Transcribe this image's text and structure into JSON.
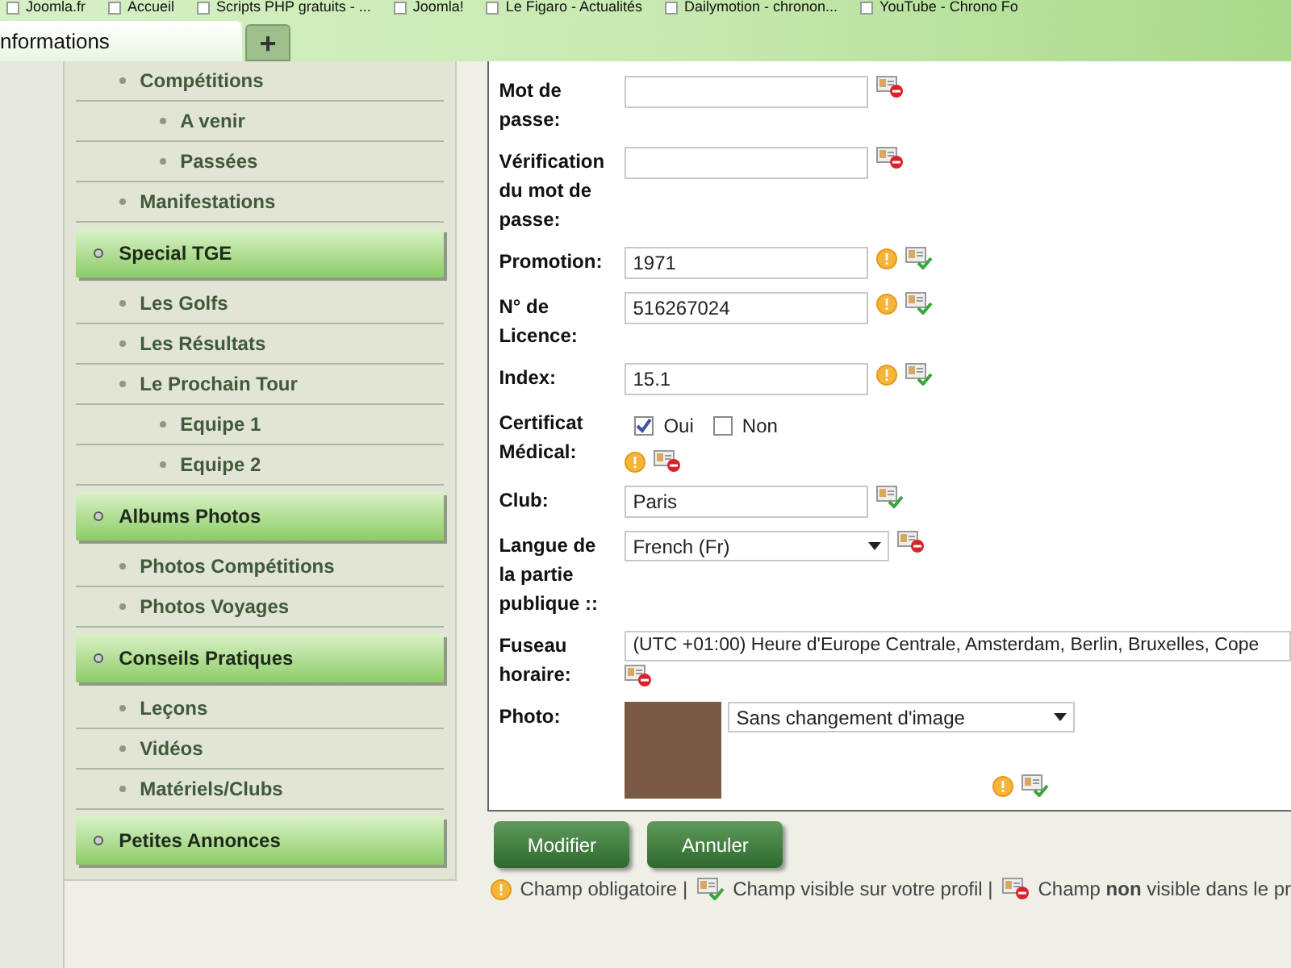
{
  "bookmarks": [
    {
      "label": "Joomla.fr"
    },
    {
      "label": "Accueil"
    },
    {
      "label": "Scripts PHP gratuits - ..."
    },
    {
      "label": "Joomla!"
    },
    {
      "label": "Le Figaro - Actualités"
    },
    {
      "label": "Dailymotion - chronon..."
    },
    {
      "label": "YouTube - Chrono Fo"
    }
  ],
  "tabs": [
    {
      "label": "nformations",
      "selected": true
    }
  ],
  "new_tab": "+",
  "sidebar": [
    {
      "kind": "link",
      "label": "Compétitions",
      "children": [
        {
          "kind": "link",
          "label": "A venir"
        },
        {
          "kind": "link",
          "label": "Passées"
        }
      ]
    },
    {
      "kind": "link",
      "label": "Manifestations"
    },
    {
      "kind": "section",
      "label": "Special TGE",
      "children": [
        {
          "kind": "link",
          "label": "Les Golfs"
        },
        {
          "kind": "link",
          "label": "Les Résultats"
        },
        {
          "kind": "link",
          "label": "Le Prochain Tour",
          "children": [
            {
              "kind": "link",
              "label": "Equipe 1"
            },
            {
              "kind": "link",
              "label": "Equipe 2"
            }
          ]
        }
      ]
    },
    {
      "kind": "section",
      "label": "Albums Photos",
      "children": [
        {
          "kind": "link",
          "label": "Photos Compétitions"
        },
        {
          "kind": "link",
          "label": "Photos Voyages"
        }
      ]
    },
    {
      "kind": "section",
      "label": "Conseils Pratiques",
      "children": [
        {
          "kind": "link",
          "label": "Leçons"
        },
        {
          "kind": "link",
          "label": "Vidéos"
        },
        {
          "kind": "link",
          "label": "Matériels/Clubs"
        }
      ]
    },
    {
      "kind": "section",
      "label": "Petites Annonces"
    }
  ],
  "form": [
    {
      "kind": "text",
      "label": "Mot de passe:",
      "required": false,
      "public": false
    },
    {
      "kind": "text",
      "label": "Vérification du mot de passe:",
      "required": false,
      "public": false
    },
    {
      "kind": "text",
      "label": "Promotion:",
      "value": "1971",
      "required": true,
      "public": true
    },
    {
      "kind": "text",
      "label": "N° de Licence:",
      "value": "516267024",
      "required": true,
      "public": true
    },
    {
      "kind": "text",
      "label": "Index:",
      "value": "15.1",
      "required": true,
      "public": true
    },
    {
      "kind": "checkboxes",
      "label": "Certificat Médical:",
      "options": [
        {
          "label": "Oui",
          "checked": true
        },
        {
          "label": "Non",
          "checked": false
        }
      ],
      "required": true,
      "public": false
    },
    {
      "kind": "text",
      "label": "Club:",
      "value": "Paris",
      "required": false,
      "public": true
    },
    {
      "kind": "select",
      "label": "Langue de la partie publique ::",
      "value": "French (Fr)",
      "required": false,
      "public": false
    },
    {
      "kind": "wide-select",
      "label": "Fuseau horaire:",
      "value": "(UTC +01:00) Heure d'Europe Centrale, Amsterdam, Berlin, Bruxelles, Cope",
      "required": false,
      "public": false
    },
    {
      "kind": "photo",
      "label": "Photo:",
      "value": "Sans changement d'image",
      "required": true,
      "public": true
    }
  ],
  "buttons": [
    "Modifier",
    "Annuler"
  ],
  "legend": [
    {
      "kind": "required",
      "text": "Champ obligatoire |"
    },
    {
      "kind": "public",
      "text": "Champ visible sur votre profil |"
    },
    {
      "kind": "private",
      "text": "Champ **non** visible dans le pr"
    }
  ]
}
